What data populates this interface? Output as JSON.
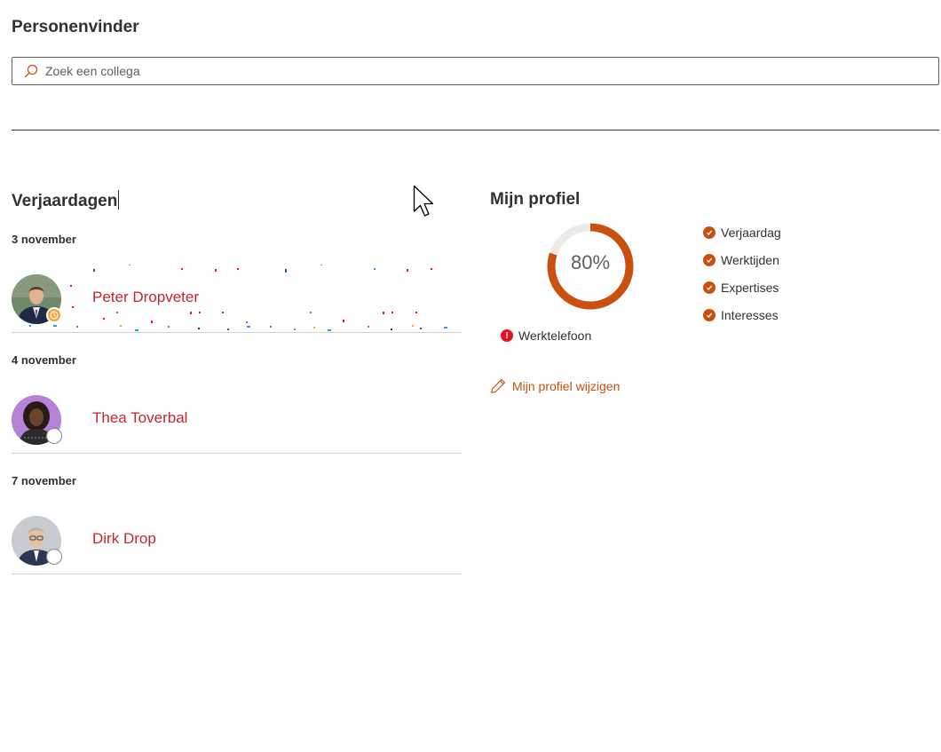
{
  "header": {
    "title": "Personenvinder"
  },
  "search": {
    "placeholder": "Zoek een collega",
    "icon": "search-icon"
  },
  "birthdays": {
    "title": "Verjaardagen",
    "groups": [
      {
        "date": "3 november",
        "name": "Peter Dropveter",
        "presence": "away"
      },
      {
        "date": "4 november",
        "name": "Thea Toverbal",
        "presence": "offline"
      },
      {
        "date": "7 november",
        "name": "Dirk Drop",
        "presence": "offline"
      }
    ]
  },
  "profile": {
    "title": "Mijn profiel",
    "completion_label": "80%",
    "completion": 0.8,
    "completed_items": [
      "Verjaardag",
      "Werktijden",
      "Expertises",
      "Interesses"
    ],
    "missing_items": [
      "Werktelefoon"
    ],
    "edit_label": "Mijn profiel wijzigen"
  },
  "colors": {
    "accent": "#ca5010",
    "name_link": "#c4262e",
    "error": "#e81123"
  }
}
